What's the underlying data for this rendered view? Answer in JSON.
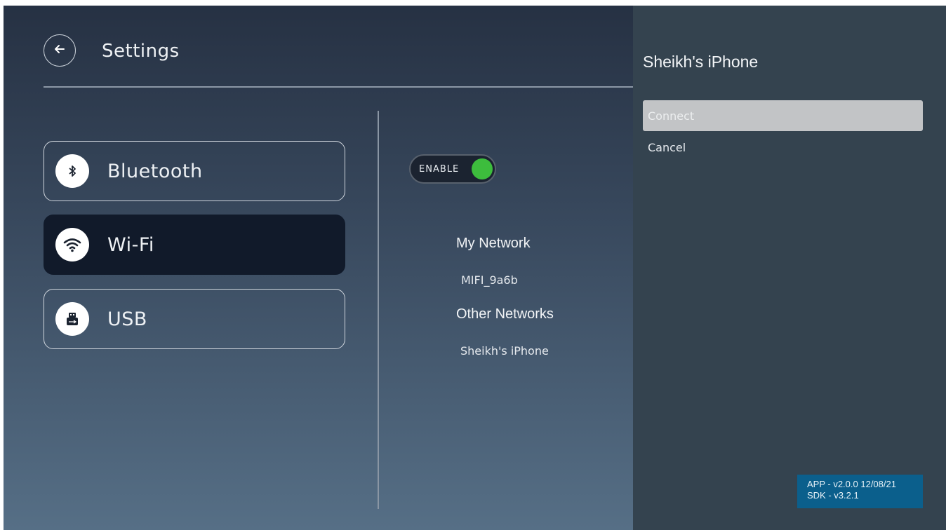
{
  "header": {
    "title": "Settings",
    "back_icon": "arrow-left-icon"
  },
  "categories": [
    {
      "label": "Bluetooth",
      "icon": "bluetooth-icon",
      "state": "outlined"
    },
    {
      "label": "Wi-Fi",
      "icon": "wifi-icon",
      "state": "selected"
    },
    {
      "label": "USB",
      "icon": "usb-icon",
      "state": "outlined"
    }
  ],
  "wifi": {
    "toggle_label": "ENABLE",
    "toggle_on": true,
    "my_network_heading": "My Network",
    "my_networks": [
      "MIFI_9a6b"
    ],
    "other_networks_heading": "Other Networks",
    "other_networks": [
      "Sheikh's iPhone"
    ]
  },
  "dialog": {
    "title": "Sheikh's iPhone",
    "options": [
      "Connect",
      "Cancel"
    ],
    "highlighted_option": "Connect"
  },
  "version": {
    "app": "APP - v2.0.0 12/08/21",
    "sdk": "SDK - v3.2.1"
  },
  "colors": {
    "toggle_on": "#3dbd3d",
    "selected_category": "#111a2a",
    "version_badge": "#0b5f8c",
    "dialog_bg": "#34434f"
  }
}
